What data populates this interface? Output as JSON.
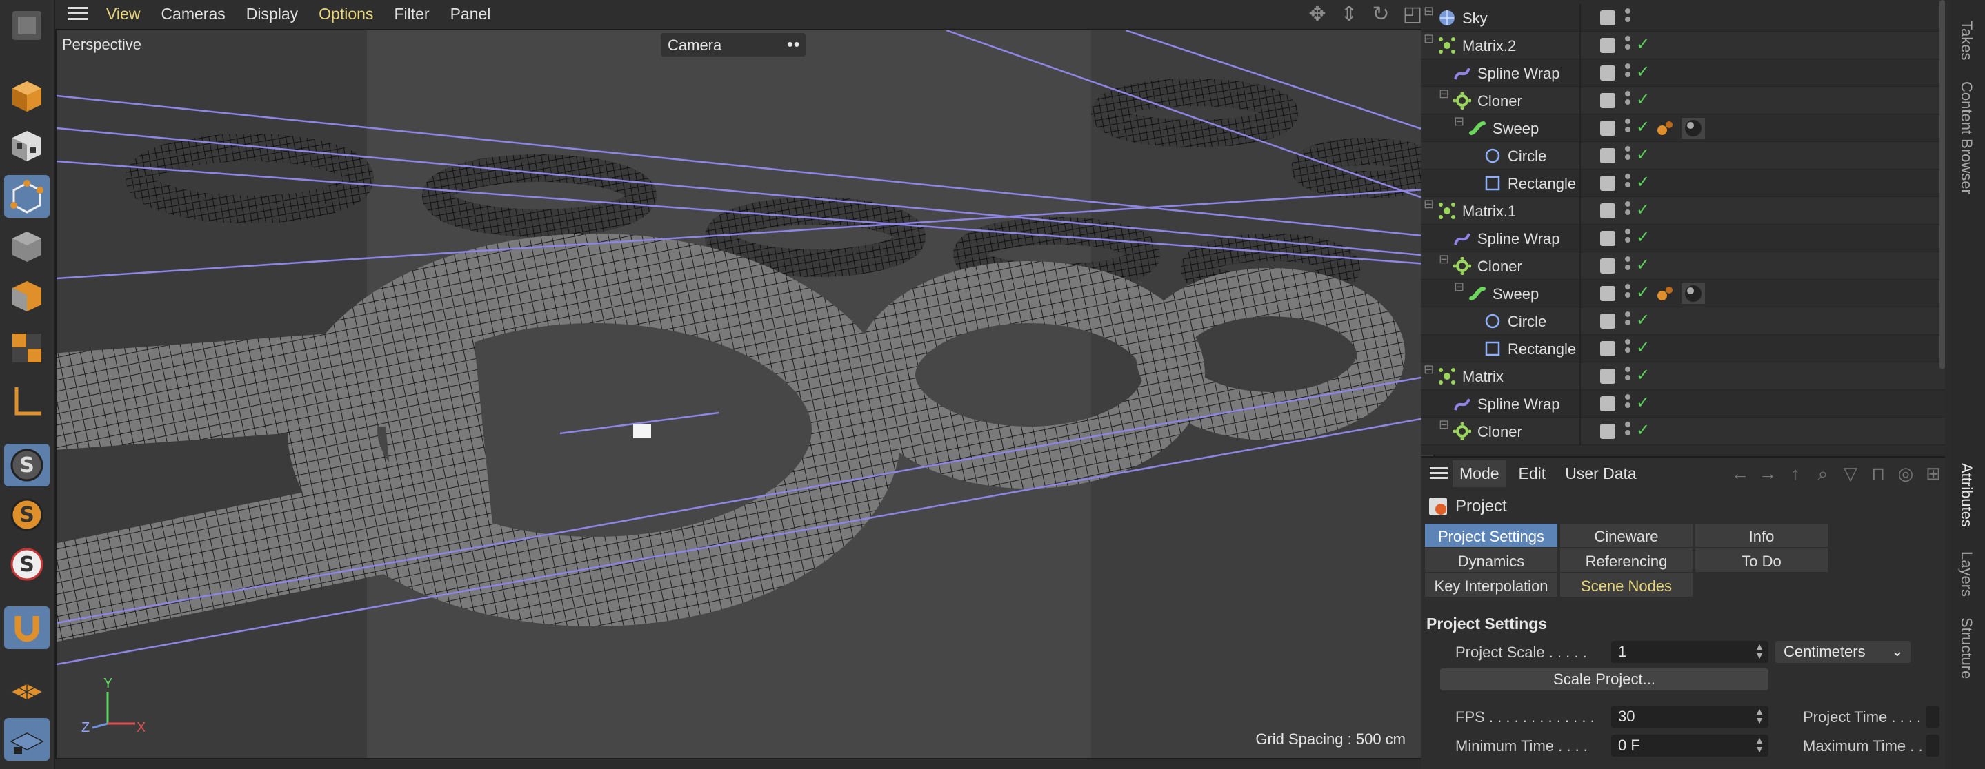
{
  "viewport": {
    "menu": [
      "View",
      "Cameras",
      "Display",
      "Options",
      "Filter",
      "Panel"
    ],
    "label": "Perspective",
    "camera": "Camera",
    "grid_spacing": "Grid Spacing : 500 cm",
    "axes": {
      "y": "Y",
      "z": "Z",
      "x": "X"
    }
  },
  "palette": {
    "tools": [
      "move-tool-icon",
      "cube-icon",
      "checker-cube-icon",
      "points-mode-icon",
      "edges-mode-icon",
      "polygons-mode-icon",
      "uv-mode-icon",
      "axis-icon",
      "snap-s-icon",
      "snap-s-orange-icon",
      "snap-s-white-icon",
      "magnet-icon",
      "workplane-icon",
      "locked-grid-icon"
    ]
  },
  "objects": {
    "rows": [
      {
        "name": "Sky",
        "icon": "sky-icon",
        "indent": 0,
        "check": false,
        "tags": false
      },
      {
        "name": "Matrix.2",
        "icon": "matrix-icon",
        "indent": 0,
        "check": true,
        "tags": false
      },
      {
        "name": "Spline Wrap",
        "icon": "spline-wrap-icon",
        "indent": 1,
        "check": true,
        "tags": false
      },
      {
        "name": "Cloner",
        "icon": "cloner-icon",
        "indent": 1,
        "check": true,
        "tags": false
      },
      {
        "name": "Sweep",
        "icon": "sweep-icon",
        "indent": 2,
        "check": true,
        "tags": true
      },
      {
        "name": "Circle",
        "icon": "circle-icon",
        "indent": 3,
        "check": true,
        "tags": false
      },
      {
        "name": "Rectangle",
        "icon": "rectangle-icon",
        "indent": 3,
        "check": true,
        "tags": false
      },
      {
        "name": "Matrix.1",
        "icon": "matrix-icon",
        "indent": 0,
        "check": true,
        "tags": false
      },
      {
        "name": "Spline Wrap",
        "icon": "spline-wrap-icon",
        "indent": 1,
        "check": true,
        "tags": false
      },
      {
        "name": "Cloner",
        "icon": "cloner-icon",
        "indent": 1,
        "check": true,
        "tags": false
      },
      {
        "name": "Sweep",
        "icon": "sweep-icon",
        "indent": 2,
        "check": true,
        "tags": true
      },
      {
        "name": "Circle",
        "icon": "circle-icon",
        "indent": 3,
        "check": true,
        "tags": false
      },
      {
        "name": "Rectangle",
        "icon": "rectangle-icon",
        "indent": 3,
        "check": true,
        "tags": false
      },
      {
        "name": "Matrix",
        "icon": "matrix-icon",
        "indent": 0,
        "check": true,
        "tags": false
      },
      {
        "name": "Spline Wrap",
        "icon": "spline-wrap-icon",
        "indent": 1,
        "check": true,
        "tags": false
      },
      {
        "name": "Cloner",
        "icon": "cloner-icon",
        "indent": 1,
        "check": true,
        "tags": false
      }
    ]
  },
  "attributes": {
    "menu": [
      "Mode",
      "Edit",
      "User Data"
    ],
    "title": "Project",
    "tabs": [
      "Project Settings",
      "Cineware",
      "Info",
      "Dynamics",
      "Referencing",
      "To Do",
      "Key Interpolation",
      "Scene Nodes"
    ],
    "section": "Project Settings",
    "project_scale_label": "Project Scale . . . . .",
    "project_scale_value": "1",
    "project_scale_unit": "Centimeters",
    "scale_project_button": "Scale Project...",
    "fps_label": "FPS . . . . . . . . . . . . .",
    "fps_value": "30",
    "project_time_label": "Project Time . . . . .",
    "min_time_label": "Minimum Time . . . .",
    "min_time_value": "0 F",
    "max_time_label": "Maximum Time . . . ."
  },
  "side_tabs": [
    "Takes",
    "Content Browser",
    "Attributes",
    "Layers",
    "Structure"
  ],
  "colors": {
    "accent": "#5d84b6",
    "check": "#5dd65d",
    "highlight": "#e8d67a",
    "orange": "#e0902a"
  }
}
